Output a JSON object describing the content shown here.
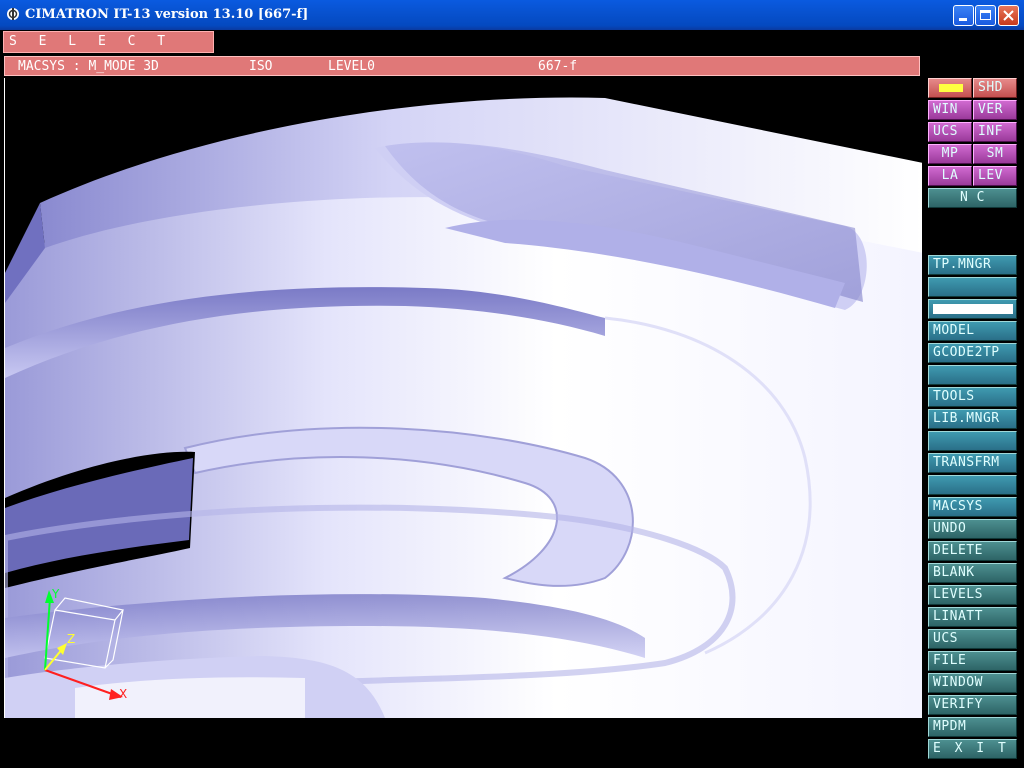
{
  "window": {
    "title": "CIMATRON IT-13 version 13.10 [667-f]",
    "colors": {
      "titlebar": "#0852d0",
      "status_bar": "#e07878",
      "panel_teal": "#2d6466",
      "panel_magenta": "#9a3a9a",
      "model_surface": "#e8e8ff"
    }
  },
  "select_bar": {
    "label": "S E L E C T"
  },
  "status_bar": {
    "macsys": "MACSYS : M_MODE 3D",
    "view": "ISO",
    "level": "LEVEL0",
    "file": "667-f"
  },
  "axis_triad": {
    "x": "X",
    "y": "Y",
    "z": "Z"
  },
  "side_panel": {
    "top_buttons": [
      {
        "label": "",
        "style": "yellow-swatch"
      },
      {
        "label": "SHD"
      },
      {
        "label": "WIN"
      },
      {
        "label": "VER"
      },
      {
        "label": "UCS"
      },
      {
        "label": "INF"
      },
      {
        "label": "MP"
      },
      {
        "label": "SM"
      },
      {
        "label": "LA"
      },
      {
        "label": "LEV"
      },
      {
        "label": "N C"
      }
    ],
    "menu": [
      {
        "label": "TP.MNGR"
      },
      {
        "label": ""
      },
      {
        "label": "",
        "style": "white-field"
      },
      {
        "label": "MODEL"
      },
      {
        "label": "GCODE2TP"
      },
      {
        "label": ""
      },
      {
        "label": "TOOLS"
      },
      {
        "label": "LIB.MNGR"
      },
      {
        "label": ""
      },
      {
        "label": "TRANSFRM"
      },
      {
        "label": ""
      },
      {
        "label": "MACSYS"
      },
      {
        "label": "UNDO"
      },
      {
        "label": "DELETE"
      },
      {
        "label": "BLANK"
      },
      {
        "label": "LEVELS"
      },
      {
        "label": "LINATT"
      },
      {
        "label": "UCS"
      },
      {
        "label": "FILE"
      },
      {
        "label": "WINDOW"
      },
      {
        "label": "VERIFY"
      },
      {
        "label": "MPDM"
      },
      {
        "label": "E X I T"
      }
    ]
  }
}
